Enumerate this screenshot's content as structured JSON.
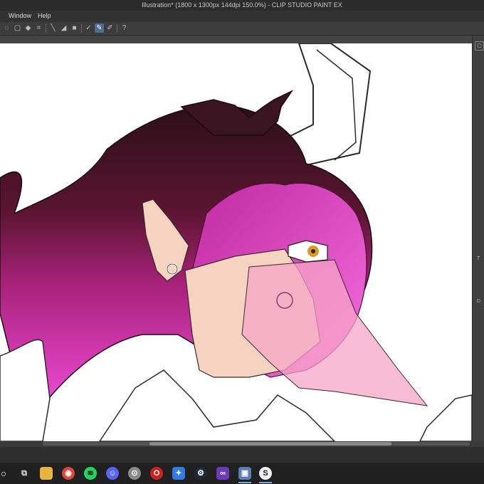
{
  "window": {
    "title": "Illustration* (1800 x 1300px 144dpi 150.0%)  - CLIP STUDIO PAINT EX"
  },
  "menu": {
    "items": [
      "Window",
      "Help"
    ]
  },
  "toolbar": {
    "buttons": [
      "lasso-select-icon",
      "select-all-icon",
      "fill-icon",
      "crop-icon",
      "line-icon",
      "shade-icon",
      "square-icon",
      "pen-icon",
      "pen-active-icon",
      "pen-alt-icon",
      "help-icon"
    ]
  },
  "colors": {
    "hair_dark": "#3a1420",
    "hair_mid": "#8a1a5a",
    "hair_pink": "#e23fc8",
    "skin": "#f6d3c0",
    "mask": "#f7a6c8",
    "accent_tab": "#4f6e8f"
  },
  "right_panel": {
    "labels": [
      "T",
      "D"
    ]
  },
  "taskbar": {
    "apps": [
      "search-icon",
      "task-view-icon",
      "file-explorer-icon",
      "chrome-icon",
      "spotify-icon",
      "discord-icon",
      "app-icon",
      "opera-icon",
      "app-blue-icon",
      "steam-icon",
      "visual-studio-icon",
      "camera-icon",
      "clip-studio-icon"
    ]
  }
}
